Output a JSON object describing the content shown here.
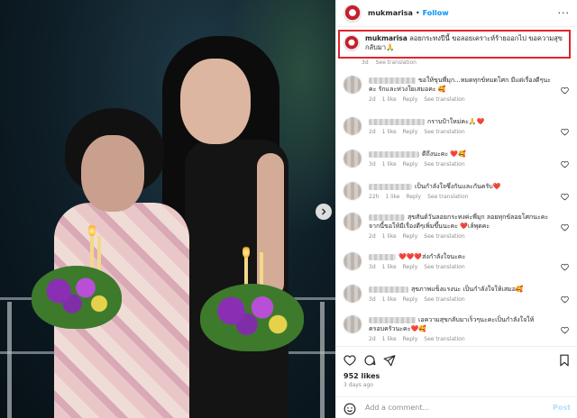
{
  "post": {
    "username": "mukmarisa",
    "dot": "•",
    "follow_label": "Follow",
    "more_label": "···"
  },
  "caption": {
    "username": "mukmarisa",
    "text": "ลอยกระทงปีนี้ ขอลอยเคราะห์ร้ายออกไป ขอความสุขกลับมา🙏",
    "age": "3d",
    "see_translation": "See translation"
  },
  "comments": [
    {
      "text": "ขอให้ขุนพี่มุก...หมดทุกข์หมดโศก มีแต่เรื่องดีๆนะคะ รักและห่วงใยเสมอคะ 🥰",
      "age": "2d",
      "likes": "1 like",
      "reply": "Reply",
      "see_translation": "See translation"
    },
    {
      "text": "กราบป้าใหม่คะ🙏❤️",
      "age": "2d",
      "likes": "1 like",
      "reply": "Reply",
      "see_translation": "See translation"
    },
    {
      "text": "ดีถึงนะคะ ❤️🥰",
      "age": "3d",
      "likes": "1 like",
      "reply": "Reply",
      "see_translation": "See translation"
    },
    {
      "text": "เป็นกำลังใจซึ่งกันและกันครับ❤️",
      "age": "22h",
      "likes": "1 like",
      "reply": "Reply",
      "see_translation": "See translation"
    },
    {
      "text": "สุขสันต์วันลอยกระทงค่ะพี่มุก ลอยทุกข์ลอยโศกนะคะ จากนี้ขอให้มีเรื่องดีๆเพิ่มขึ้นนะคะ ❤️เล้พุดคะ",
      "age": "2d",
      "likes": "1 like",
      "reply": "Reply",
      "see_translation": "See translation"
    },
    {
      "text": "❤️❤️❤️ส่งกำลังใจนะคะ",
      "age": "3d",
      "likes": "1 like",
      "reply": "Reply",
      "see_translation": "See translation"
    },
    {
      "text": "สุขภาพแข็งแรงนะ เป็นกำลังใจให้เสมอ🥰",
      "age": "3d",
      "likes": "1 like",
      "reply": "Reply",
      "see_translation": "See translation"
    },
    {
      "text": "เอความสุขกลับมาเร็วๆนะคะเป็นกำลังใจให้ครอบครัวนะคะ❤️🥰",
      "age": "2d",
      "likes": "1 like",
      "reply": "Reply",
      "see_translation": "See translation"
    }
  ],
  "footer": {
    "likes": "952 likes",
    "age": "3 days ago",
    "add_comment_placeholder": "Add a comment...",
    "post_label": "Post"
  },
  "colors": {
    "accent": "#0095f6",
    "highlight_border": "#e0262b",
    "heart": "#ed4956"
  },
  "icons": [
    "heart-icon",
    "comment-icon",
    "share-icon",
    "bookmark-icon",
    "emoji-icon",
    "chevron-right-icon",
    "more-icon"
  ]
}
